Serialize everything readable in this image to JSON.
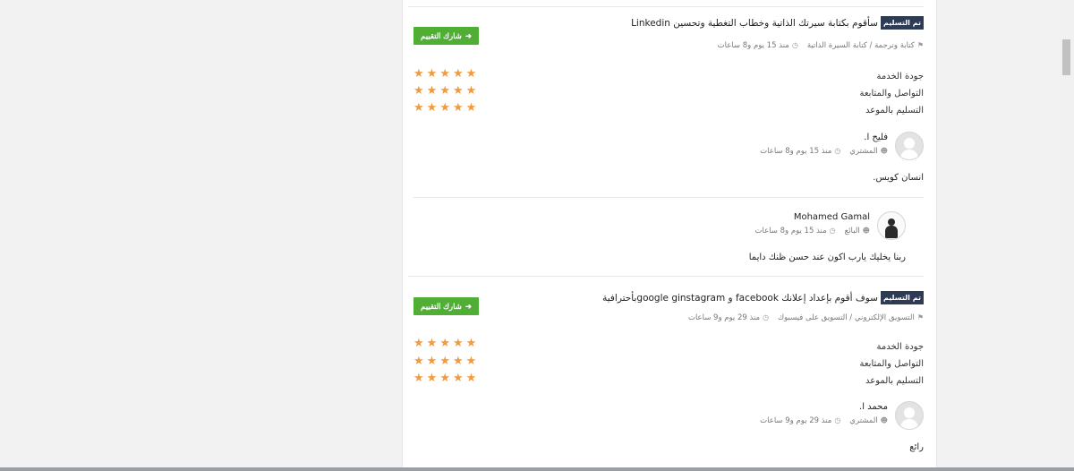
{
  "reviews": [
    {
      "badge": "تم التسليم",
      "title": "سأقوم بكتابة سيرتك الذاتية وخطاب التغطية وتحسين Linkedin",
      "category": "كتابة وترجمة / كتابة السيرة الذاتية",
      "time": "منذ 15 يوم و8 ساعات",
      "share_label": "شارك التقييم",
      "ratings": [
        {
          "label": "جودة الخدمة",
          "stars": 5
        },
        {
          "label": "التواصل والمتابعة",
          "stars": 5
        },
        {
          "label": "التسليم بالموعد",
          "stars": 5
        }
      ],
      "buyer": {
        "name": "فليح ا.",
        "role": "المشتري",
        "time": "منذ 15 يوم و8 ساعات",
        "comment": "انسان كويس."
      },
      "seller": {
        "name": "Mohamed Gamal",
        "role": "البائع",
        "time": "منذ 15 يوم و8 ساعات",
        "comment": "ربنا يخليك يارب اكون عند حسن ظنك دايما"
      }
    },
    {
      "badge": "تم التسليم",
      "title": "سوف أقوم بإعداد إعلانك facebook و google ginstagramبأحترافية",
      "category": "التسويق الإلكتروني / التسويق على فيسبوك",
      "time": "منذ 29 يوم و9 ساعات",
      "share_label": "شارك التقييم",
      "ratings": [
        {
          "label": "جودة الخدمة",
          "stars": 5
        },
        {
          "label": "التواصل والمتابعة",
          "stars": 5
        },
        {
          "label": "التسليم بالموعد",
          "stars": 5
        }
      ],
      "buyer": {
        "name": "محمد ا.",
        "role": "المشتري",
        "time": "منذ 29 يوم و9 ساعات",
        "comment": "رائع"
      }
    }
  ],
  "icons": {
    "tag": "tag-icon",
    "clock": "clock-icon",
    "user": "user-icon",
    "share": "share-icon",
    "star": "star-icon"
  },
  "colors": {
    "badge": "#2d3b55",
    "share_button": "#4fae33",
    "star": "#f19a3e"
  }
}
